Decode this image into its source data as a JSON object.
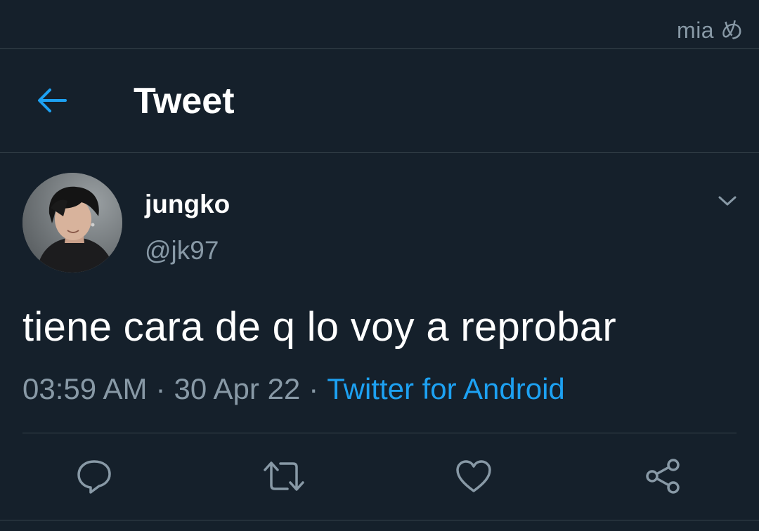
{
  "status_bar": {
    "text": "mia め"
  },
  "header": {
    "title": "Tweet",
    "back_icon": "arrow-left-icon"
  },
  "tweet": {
    "author": {
      "display_name": "jungko",
      "handle": "@jk97"
    },
    "text": "tiene cara de q lo voy a reprobar",
    "time": "03:59 AM",
    "date": "30 Apr 22",
    "separator": "·",
    "source": "Twitter for Android"
  },
  "actions": [
    {
      "name": "reply",
      "icon": "reply-icon"
    },
    {
      "name": "retweet",
      "icon": "retweet-icon"
    },
    {
      "name": "like",
      "icon": "heart-icon"
    },
    {
      "name": "share",
      "icon": "share-icon"
    }
  ],
  "colors": {
    "background": "#15202b",
    "accent": "#1da1f2",
    "secondary_text": "#8899a6",
    "divider": "#38444d"
  }
}
